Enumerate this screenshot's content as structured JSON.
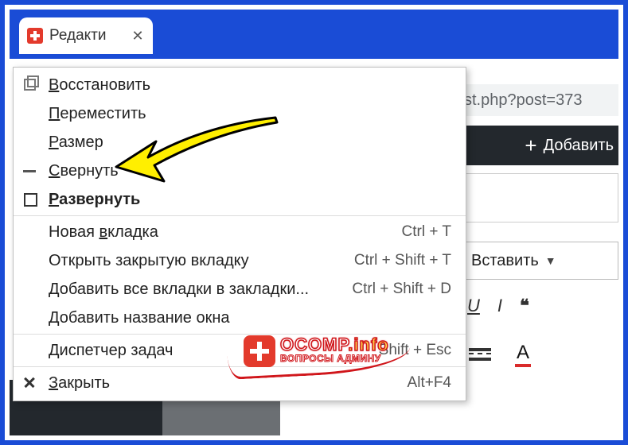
{
  "tab": {
    "title": "Редакти",
    "close_glyph": "✕"
  },
  "url_fragment": "st.php?post=373",
  "add_button": {
    "label": "Добавить",
    "plus": "+"
  },
  "insert_button": {
    "label": "Вставить",
    "caret": "▼"
  },
  "format": {
    "underline": "U",
    "italic": "I",
    "quote": "❝",
    "color_letter": "A"
  },
  "menu": {
    "items": [
      {
        "key": "restore",
        "label_pre": "",
        "mnemonic": "В",
        "label_post": "осстановить",
        "shortcut": "",
        "icon": "restore",
        "bold": false
      },
      {
        "key": "move",
        "label_pre": "",
        "mnemonic": "П",
        "label_post": "ереместить",
        "shortcut": "",
        "icon": "",
        "bold": false
      },
      {
        "key": "size",
        "label_pre": "",
        "mnemonic": "Р",
        "label_post": "азмер",
        "shortcut": "",
        "icon": "",
        "bold": false
      },
      {
        "key": "minimize",
        "label_pre": "",
        "mnemonic": "С",
        "label_post": "вернуть",
        "shortcut": "",
        "icon": "minimize",
        "bold": false
      },
      {
        "key": "maximize",
        "label_pre": "",
        "mnemonic": "Р",
        "label_post": "азвернуть",
        "shortcut": "",
        "icon": "maximize",
        "bold": true
      }
    ],
    "items2": [
      {
        "key": "newtab",
        "label_pre": "Новая ",
        "mnemonic": "в",
        "label_post": "кладка",
        "shortcut": "Ctrl + T"
      },
      {
        "key": "reopen",
        "label_pre": "Открыть закрытую вкладку",
        "mnemonic": "",
        "label_post": "",
        "shortcut": "Ctrl + Shift + T"
      },
      {
        "key": "bookmark",
        "label_pre": "Добавить все вкладки в закладки...",
        "mnemonic": "",
        "label_post": "",
        "shortcut": "Ctrl + Shift + D"
      },
      {
        "key": "name",
        "label_pre": "Добавить название окна",
        "mnemonic": "",
        "label_post": "",
        "shortcut": ""
      }
    ],
    "items3": [
      {
        "key": "taskmgr",
        "label_pre": "Диспетчер задач",
        "mnemonic": "",
        "label_post": "",
        "shortcut": "Shift + Esc"
      }
    ],
    "items4": [
      {
        "key": "close",
        "label_pre": "",
        "mnemonic": "З",
        "label_post": "акрыть",
        "shortcut": "Alt+F4",
        "icon": "closex"
      }
    ]
  },
  "watermark": {
    "line1a": "OCOMP",
    "line1b": ".info",
    "line2": "ВОПРОСЫ АДМИНУ"
  }
}
